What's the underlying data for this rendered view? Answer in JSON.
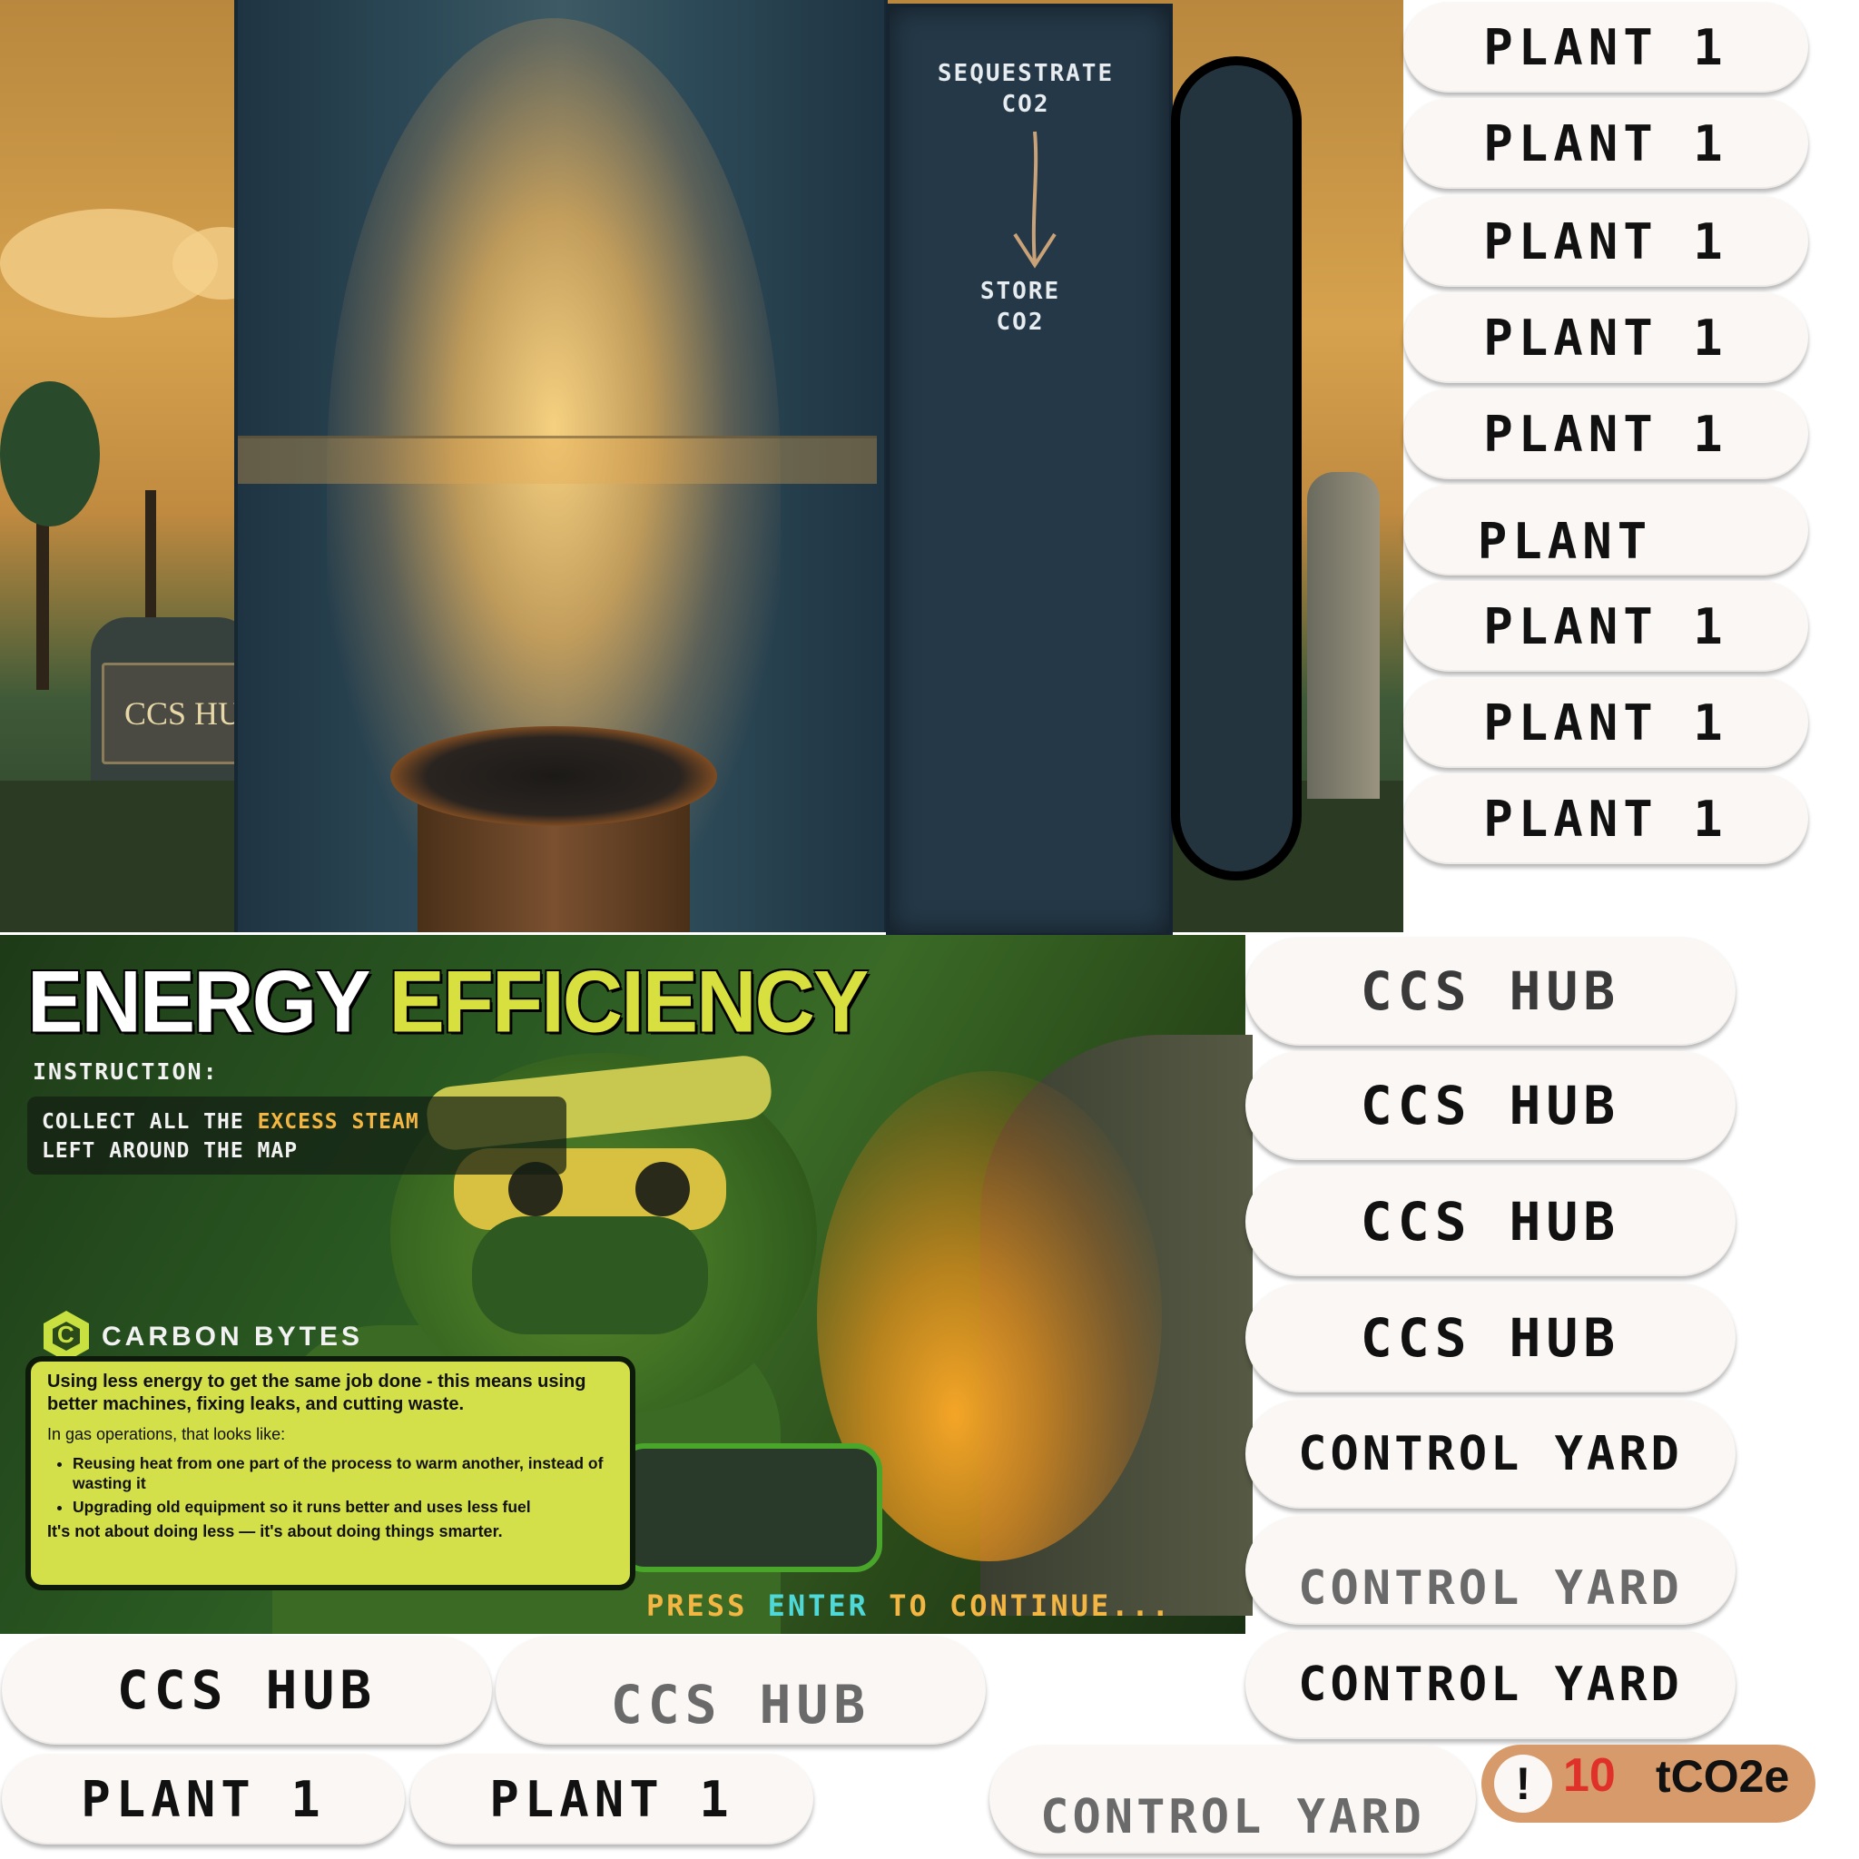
{
  "top_scene": {
    "sign_text": "CCS HU",
    "panel_label_top": "SEQUESTRATE",
    "panel_label_top_2": "CO2",
    "panel_label_bottom": "STORE",
    "panel_label_bottom_2": "CO2"
  },
  "plant_buttons": [
    {
      "label": "PLANT 1"
    },
    {
      "label": "PLANT 1"
    },
    {
      "label": "PLANT 1"
    },
    {
      "label": "PLANT 1"
    },
    {
      "label": "PLANT 1"
    },
    {
      "label": "PLANT"
    },
    {
      "label": "PLANT 1"
    },
    {
      "label": "PLANT 1"
    },
    {
      "label": "PLANT 1"
    }
  ],
  "hub_buttons": [
    {
      "label": "CCS HUB"
    },
    {
      "label": "CCS HUB"
    },
    {
      "label": "CCS HUB"
    },
    {
      "label": "CCS HUB"
    }
  ],
  "yard_buttons": [
    {
      "label": "CONTROL YARD"
    },
    {
      "label": "CONTROL YARD"
    },
    {
      "label": "CONTROL YARD"
    }
  ],
  "bottom_row": {
    "hub_1": "CCS HUB",
    "hub_2": "CCS HUB",
    "plant_1": "PLANT 1",
    "plant_2": "PLANT 1",
    "yard": "CONTROL YARD"
  },
  "energy_panel": {
    "title_word_1": "ENERGY",
    "title_word_2": "EFFICIENCY",
    "instruction_label": "INSTRUCTION:",
    "instruction_part_1": "COLLECT ALL THE ",
    "instruction_highlight": "EXCESS STEAM",
    "instruction_part_2": "LEFT AROUND THE MAP",
    "brand": "CARBON BYTES",
    "info_lead": "Using less energy to get the same job done - this means using better machines, fixing leaks, and cutting waste.",
    "info_sub": "In gas operations, that looks like:",
    "info_bullets": [
      "Reusing heat from one part of the process to warm another, instead of wasting it",
      "Upgrading old equipment so it runs better and uses less fuel"
    ],
    "info_footer": "It's not about doing less — it's about doing things smarter.",
    "press_part_1": "PRESS ",
    "press_key": "ENTER",
    "press_part_2": " TO CONTINUE..."
  },
  "counter": {
    "alert_icon": "exclamation-icon",
    "value": "10",
    "unit": "tCO2e"
  },
  "colors": {
    "accent_yellow": "#d8e040",
    "accent_orange": "#f4b642",
    "accent_cyan": "#4ed8d8",
    "counter_bg": "#d79a6a",
    "counter_value": "#e0302a"
  }
}
